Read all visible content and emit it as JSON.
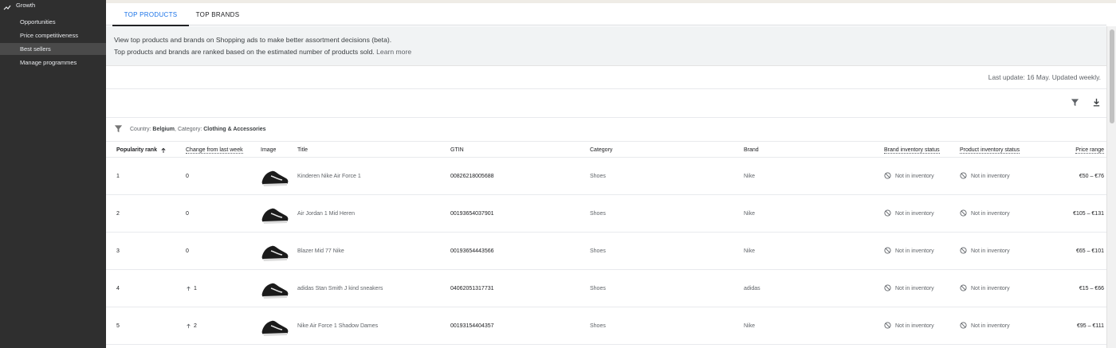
{
  "sidebar": {
    "section": {
      "label": "Growth",
      "icon": "trending-up-icon"
    },
    "items": [
      {
        "label": "Opportunities",
        "active": false
      },
      {
        "label": "Price competitiveness",
        "active": false
      },
      {
        "label": "Best sellers",
        "active": true
      },
      {
        "label": "Manage programmes",
        "active": false
      }
    ]
  },
  "tabs": [
    {
      "label": "TOP PRODUCTS",
      "active": true
    },
    {
      "label": "TOP BRANDS",
      "active": false
    }
  ],
  "info": {
    "line1": "View top products and brands on Shopping ads to make better assortment decisions (beta).",
    "line2": "Top products and brands are ranked based on the estimated number of products sold.",
    "learn_more": "Learn more"
  },
  "last_update": "Last update: 16 May. Updated weekly.",
  "filter": {
    "country_label": "Country:",
    "country": "Belgium",
    "category_label": "Category:",
    "category": "Clothing & Accessories"
  },
  "table": {
    "headers": {
      "rank": "Popularity rank",
      "change": "Change from last week",
      "image": "Image",
      "title": "Title",
      "gtin": "GTIN",
      "category": "Category",
      "brand": "Brand",
      "brand_inv": "Brand inventory status",
      "product_inv": "Product inventory status",
      "price": "Price range"
    },
    "rows": [
      {
        "rank": "1",
        "change": "0",
        "up": false,
        "title": "Kinderen Nike Air Force 1",
        "gtin": "00826218005688",
        "category": "Shoes",
        "brand": "Nike",
        "brand_inv": "Not in inventory",
        "product_inv": "Not in inventory",
        "price": "€50 – €76"
      },
      {
        "rank": "2",
        "change": "0",
        "up": false,
        "title": "Air Jordan 1 Mid Heren",
        "gtin": "00193654037901",
        "category": "Shoes",
        "brand": "Nike",
        "brand_inv": "Not in inventory",
        "product_inv": "Not in inventory",
        "price": "€105 – €131"
      },
      {
        "rank": "3",
        "change": "0",
        "up": false,
        "title": "Blazer Mid 77 Nike",
        "gtin": "00193654443566",
        "category": "Shoes",
        "brand": "Nike",
        "brand_inv": "Not in inventory",
        "product_inv": "Not in inventory",
        "price": "€65 – €101"
      },
      {
        "rank": "4",
        "change": "1",
        "up": true,
        "title": "adidas Stan Smith J kind sneakers",
        "gtin": "04062051317731",
        "category": "Shoes",
        "brand": "adidas",
        "brand_inv": "Not in inventory",
        "product_inv": "Not in inventory",
        "price": "€15 – €66"
      },
      {
        "rank": "5",
        "change": "2",
        "up": true,
        "title": "Nike Air Force 1 Shadow Dames",
        "gtin": "00193154404357",
        "category": "Shoes",
        "brand": "Nike",
        "brand_inv": "Not in inventory",
        "product_inv": "Not in inventory",
        "price": "€95 – €111"
      }
    ]
  },
  "colors": {
    "sidebar_bg": "#2f2f2f",
    "active_tab": "#1a73e8",
    "info_bg": "#f1f3f4"
  }
}
